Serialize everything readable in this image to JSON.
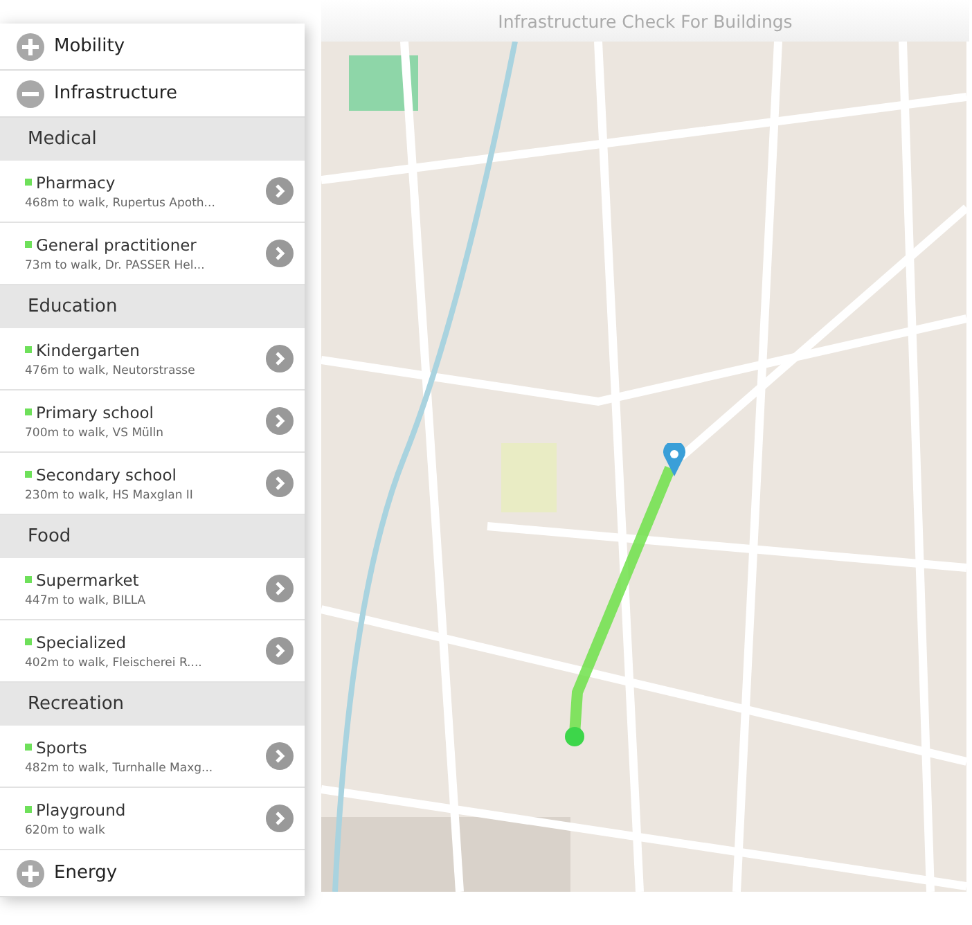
{
  "header": {
    "title": "Infrastructure Check For Buildings"
  },
  "sidebar": {
    "sections": [
      {
        "label": "Mobility",
        "expanded": false
      },
      {
        "label": "Infrastructure",
        "expanded": true,
        "categories": [
          {
            "label": "Medical",
            "items": [
              {
                "name": "Pharmacy",
                "detail": "468m to walk, Rupertus Apoth..."
              },
              {
                "name": "General practitioner",
                "detail": "73m to walk, Dr. PASSER Hel..."
              }
            ]
          },
          {
            "label": "Education",
            "items": [
              {
                "name": "Kindergarten",
                "detail": "476m to walk, Neutorstrasse"
              },
              {
                "name": "Primary school",
                "detail": "700m to walk, VS Mülln"
              },
              {
                "name": "Secondary school",
                "detail": "230m to walk, HS Maxglan II"
              }
            ]
          },
          {
            "label": "Food",
            "items": [
              {
                "name": "Supermarket",
                "detail": "447m to walk, BILLA"
              },
              {
                "name": "Specialized",
                "detail": "402m to walk, Fleischerei R...."
              }
            ]
          },
          {
            "label": "Recreation",
            "items": [
              {
                "name": "Sports",
                "detail": "482m to walk, Turnhalle Maxg..."
              },
              {
                "name": "Playground",
                "detail": "620m to walk"
              }
            ]
          }
        ]
      },
      {
        "label": "Energy",
        "expanded": false
      }
    ]
  }
}
